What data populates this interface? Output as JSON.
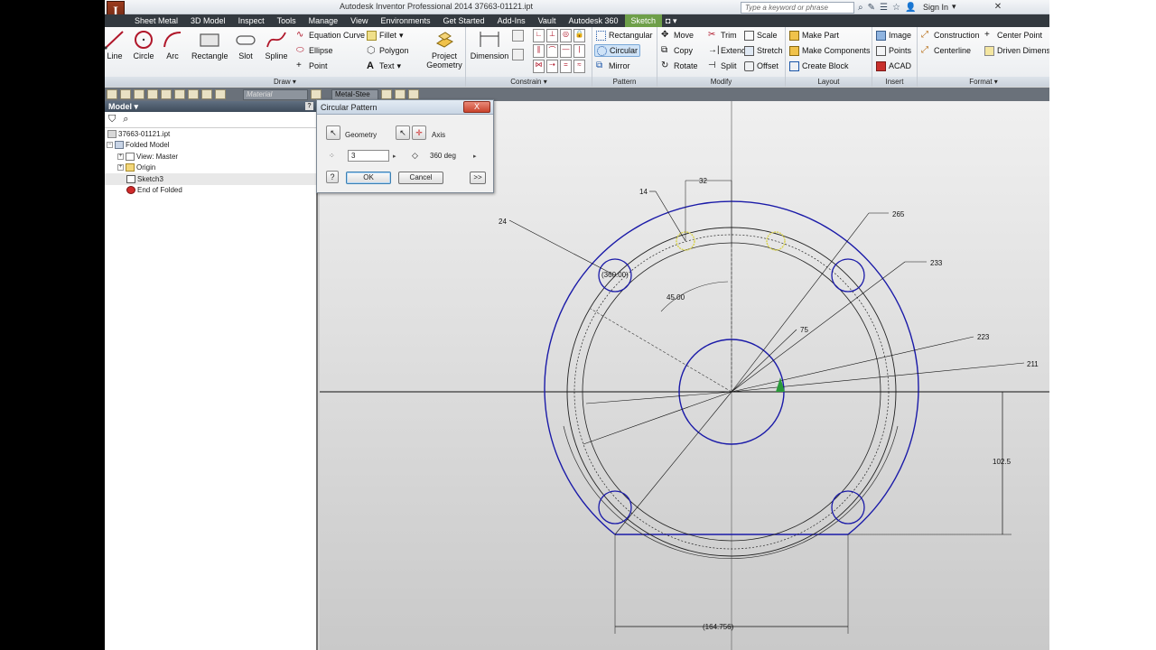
{
  "window": {
    "logo_letter": "I",
    "logo_sub": "PRO",
    "title": "Autodesk Inventor Professional 2014   37663-01121.ipt",
    "search_placeholder": "Type a keyword or phrase",
    "sign_in": "Sign In"
  },
  "menu_tabs": [
    "Sheet Metal",
    "3D Model",
    "Inspect",
    "Tools",
    "Manage",
    "View",
    "Environments",
    "Get Started",
    "Add-Ins",
    "Vault",
    "Autodesk 360",
    "Sketch"
  ],
  "active_tab": "Sketch",
  "ribbon": {
    "draw": {
      "label": "Draw",
      "line": "Line",
      "circle": "Circle",
      "arc": "Arc",
      "rectangle": "Rectangle",
      "slot": "Slot",
      "spline": "Spline",
      "equation_curve": "Equation Curve",
      "ellipse": "Ellipse",
      "point": "Point",
      "fillet": "Fillet",
      "polygon": "Polygon",
      "text": "Text",
      "project_geometry_1": "Project",
      "project_geometry_2": "Geometry"
    },
    "constrain": {
      "label": "Constrain",
      "dimension": "Dimension"
    },
    "pattern": {
      "label": "Pattern",
      "rectangular": "Rectangular",
      "circular": "Circular",
      "mirror": "Mirror"
    },
    "modify": {
      "label": "Modify",
      "move": "Move",
      "copy": "Copy",
      "rotate": "Rotate",
      "trim": "Trim",
      "extend": "Extend",
      "split": "Split",
      "scale": "Scale",
      "stretch": "Stretch",
      "offset": "Offset"
    },
    "layout": {
      "label": "Layout",
      "make_part": "Make Part",
      "make_components": "Make Components",
      "create_block": "Create Block"
    },
    "insert": {
      "label": "Insert",
      "image": "Image",
      "points": "Points",
      "acad": "ACAD"
    },
    "format": {
      "label": "Format",
      "construction": "Construction",
      "centerline": "Centerline",
      "center_point": "Center Point",
      "driven_dimension": "Driven Dimension"
    }
  },
  "quickbar": {
    "material": "Material",
    "style": "Metal-Stee"
  },
  "browser": {
    "title": "Model",
    "help": "?",
    "items": [
      {
        "label": "37663-01121.ipt",
        "depth": 0,
        "icon": "part-icon"
      },
      {
        "label": "Folded Model",
        "depth": 1,
        "icon": "folded-model-icon"
      },
      {
        "label": "View: Master",
        "depth": 2,
        "icon": "view-icon"
      },
      {
        "label": "Origin",
        "depth": 2,
        "icon": "folder-icon"
      },
      {
        "label": "Sketch3",
        "depth": 2,
        "icon": "sketch-icon"
      },
      {
        "label": "End of Folded",
        "depth": 2,
        "icon": "end-of-part-icon"
      }
    ]
  },
  "dialog": {
    "title": "Circular Pattern",
    "close": "X",
    "geometry_label": "Geometry",
    "axis_label": "Axis",
    "count_value": "3",
    "angle_value": "360 deg",
    "ok": "OK",
    "cancel": "Cancel",
    "more": ">>"
  },
  "dimensions": {
    "d32": "32",
    "d14": "14",
    "d24": "24",
    "d265": "265",
    "d233": "233",
    "d360": "(360.00)",
    "d45": "45.00",
    "d75": "75",
    "d223": "223",
    "d211": "211",
    "d102": "102.5",
    "d164": "(164.756)"
  },
  "colors": {
    "sketch_blue": "#1a1aa8",
    "ribbon_active": "#6e9f49",
    "menubar": "#33393f"
  }
}
